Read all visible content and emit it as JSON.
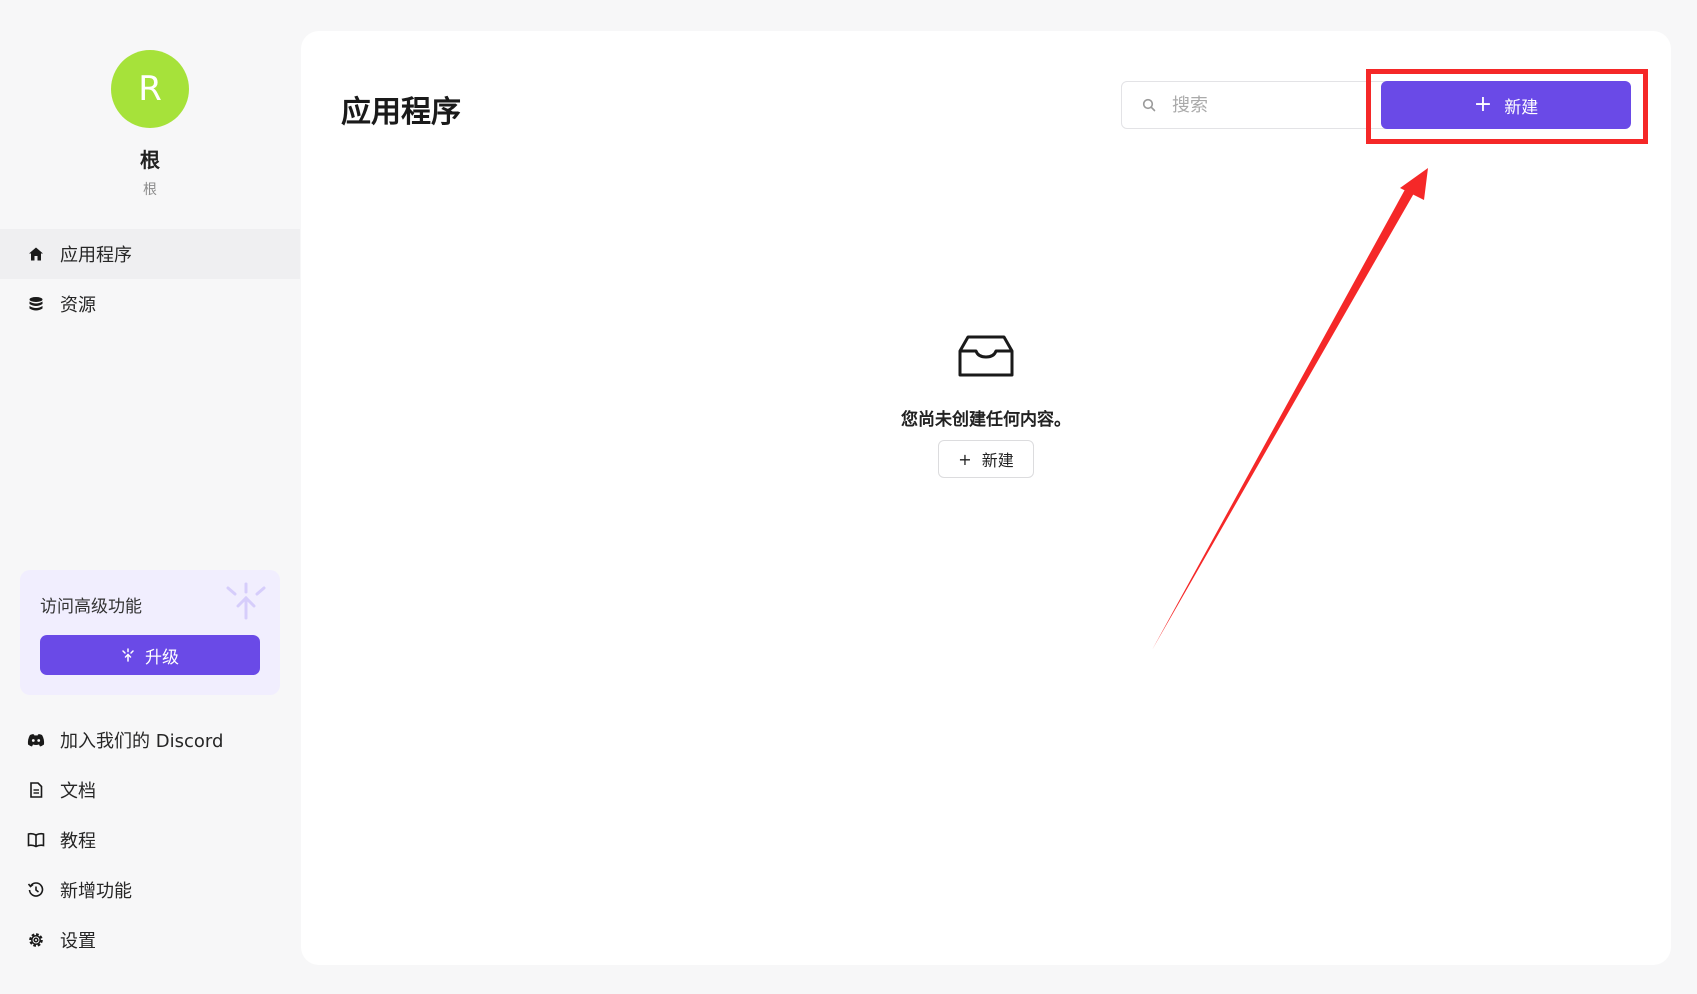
{
  "profile": {
    "avatar_letter": "R",
    "name": "根",
    "subtitle": "根"
  },
  "sidebar": {
    "items": [
      {
        "label": "应用程序",
        "icon": "home-icon"
      },
      {
        "label": "资源",
        "icon": "database-icon"
      }
    ],
    "upgrade": {
      "title": "访问高级功能",
      "button_label": "升级"
    },
    "bottom_items": [
      {
        "label": "加入我们的 Discord",
        "icon": "discord-icon"
      },
      {
        "label": "文档",
        "icon": "document-icon"
      },
      {
        "label": "教程",
        "icon": "book-icon"
      },
      {
        "label": "新增功能",
        "icon": "history-icon"
      },
      {
        "label": "设置",
        "icon": "gear-icon"
      }
    ]
  },
  "main": {
    "title": "应用程序",
    "search": {
      "placeholder": "搜索",
      "value": ""
    },
    "new_button_label": "新建",
    "empty_state": {
      "message": "您尚未创建任何内容。",
      "button_label": "新建"
    }
  },
  "colors": {
    "accent": "#6a4ae7",
    "avatar": "#a6e23a",
    "annotation": "#f52828"
  }
}
